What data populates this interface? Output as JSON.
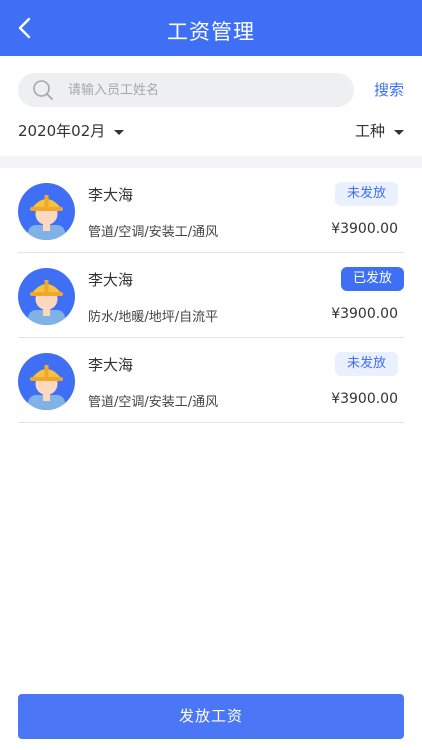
{
  "header": {
    "title": "工资管理"
  },
  "search": {
    "placeholder": "请输入员工姓名",
    "button_label": "搜索"
  },
  "filters": {
    "month": "2020年02月",
    "trade": "工种"
  },
  "workers": [
    {
      "name": "李大海",
      "trade": "管道/空调/安装工/通风",
      "amount": "¥3900.00",
      "status": "未发放",
      "paid": false
    },
    {
      "name": "李大海",
      "trade": "防水/地暖/地坪/自流平",
      "amount": "¥3900.00",
      "status": "已发放",
      "paid": true
    },
    {
      "name": "李大海",
      "trade": "管道/空调/安装工/通风",
      "amount": "¥3900.00",
      "status": "未发放",
      "paid": false
    }
  ],
  "footer": {
    "button_label": "发放工资"
  },
  "colors": {
    "primary": "#3f6ff5",
    "badge_unpaid_bg": "#eaf0fd",
    "helmet": "#f7c33a",
    "skin": "#fcd9be"
  }
}
